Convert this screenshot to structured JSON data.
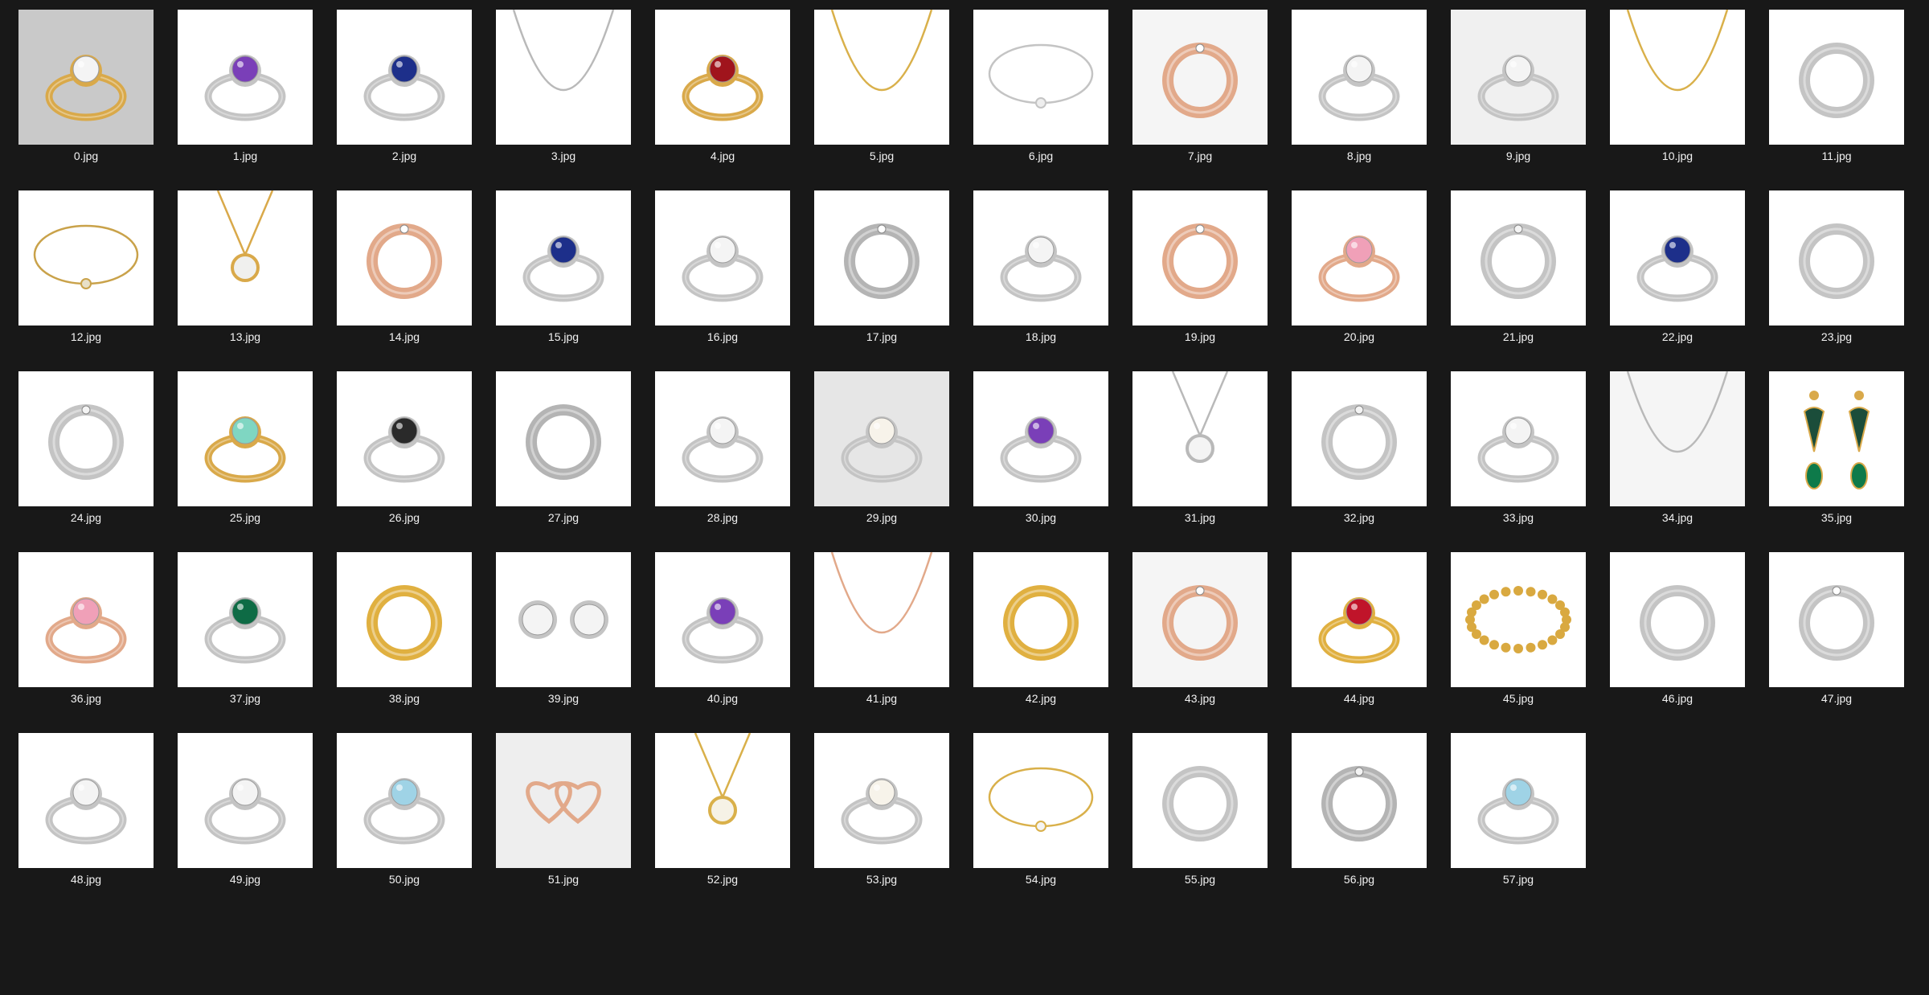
{
  "files": [
    {
      "name": "0.jpg",
      "item": "ring",
      "metal": "#d9a94a",
      "gem": "#f4f4f4",
      "bg": "#c9c9c9"
    },
    {
      "name": "1.jpg",
      "item": "ring",
      "metal": "#c4c4c4",
      "gem": "#7a3fb8",
      "bg": "#ffffff"
    },
    {
      "name": "2.jpg",
      "item": "ring",
      "metal": "#c4c4c4",
      "gem": "#1d2f8a",
      "bg": "#ffffff"
    },
    {
      "name": "3.jpg",
      "item": "necklace",
      "metal": "#b9b9b9",
      "gem": "",
      "bg": "#ffffff"
    },
    {
      "name": "4.jpg",
      "item": "ring",
      "metal": "#d9a94a",
      "gem": "#a0141c",
      "bg": "#ffffff"
    },
    {
      "name": "5.jpg",
      "item": "necklace",
      "metal": "#d9b04a",
      "gem": "",
      "bg": "#ffffff"
    },
    {
      "name": "6.jpg",
      "item": "bracelet",
      "metal": "#c4c4c4",
      "gem": "#eeeeee",
      "bg": "#ffffff"
    },
    {
      "name": "7.jpg",
      "item": "band",
      "metal": "#e2a98a",
      "gem": "#ffffff",
      "bg": "#f5f5f5"
    },
    {
      "name": "8.jpg",
      "item": "ring",
      "metal": "#c4c4c4",
      "gem": "#f4f4f4",
      "bg": "#ffffff"
    },
    {
      "name": "9.jpg",
      "item": "ring",
      "metal": "#c4c4c4",
      "gem": "#f4f4f4",
      "bg": "#f0f0f0"
    },
    {
      "name": "10.jpg",
      "item": "necklace",
      "metal": "#d9b04a",
      "gem": "",
      "bg": "#ffffff"
    },
    {
      "name": "11.jpg",
      "item": "band",
      "metal": "#c4c4c4",
      "gem": "",
      "bg": "#ffffff"
    },
    {
      "name": "12.jpg",
      "item": "bracelet",
      "metal": "#c9a24a",
      "gem": "#e8e0c8",
      "bg": "#ffffff"
    },
    {
      "name": "13.jpg",
      "item": "pendant",
      "metal": "#d9a94a",
      "gem": "#f0f0ee",
      "bg": "#ffffff"
    },
    {
      "name": "14.jpg",
      "item": "band",
      "metal": "#e2a98a",
      "gem": "#ffffff",
      "bg": "#ffffff"
    },
    {
      "name": "15.jpg",
      "item": "ring",
      "metal": "#c4c4c4",
      "gem": "#1d2f8a",
      "bg": "#ffffff"
    },
    {
      "name": "16.jpg",
      "item": "ring",
      "metal": "#c4c4c4",
      "gem": "#f4f4f4",
      "bg": "#ffffff"
    },
    {
      "name": "17.jpg",
      "item": "band",
      "metal": "#b4b4b4",
      "gem": "#ffffff",
      "bg": "#ffffff"
    },
    {
      "name": "18.jpg",
      "item": "ring",
      "metal": "#c4c4c4",
      "gem": "#f4f4f4",
      "bg": "#ffffff"
    },
    {
      "name": "19.jpg",
      "item": "band",
      "metal": "#e2a98a",
      "gem": "#ffffff",
      "bg": "#ffffff"
    },
    {
      "name": "20.jpg",
      "item": "ring",
      "metal": "#e2a98a",
      "gem": "#f0a0b8",
      "bg": "#ffffff"
    },
    {
      "name": "21.jpg",
      "item": "band",
      "metal": "#c4c4c4",
      "gem": "#f4f4f4",
      "bg": "#ffffff"
    },
    {
      "name": "22.jpg",
      "item": "ring",
      "metal": "#c4c4c4",
      "gem": "#1d2f8a",
      "bg": "#ffffff"
    },
    {
      "name": "23.jpg",
      "item": "band",
      "metal": "#c4c4c4",
      "gem": "",
      "bg": "#ffffff"
    },
    {
      "name": "24.jpg",
      "item": "band",
      "metal": "#c4c4c4",
      "gem": "#f4f4f4",
      "bg": "#ffffff"
    },
    {
      "name": "25.jpg",
      "item": "ring",
      "metal": "#d9a94a",
      "gem": "#7fd6c2",
      "bg": "#ffffff"
    },
    {
      "name": "26.jpg",
      "item": "ring",
      "metal": "#c4c4c4",
      "gem": "#2a2a2a",
      "bg": "#ffffff"
    },
    {
      "name": "27.jpg",
      "item": "band",
      "metal": "#b4b4b4",
      "gem": "",
      "bg": "#ffffff"
    },
    {
      "name": "28.jpg",
      "item": "ring",
      "metal": "#c4c4c4",
      "gem": "#f4f4f4",
      "bg": "#ffffff"
    },
    {
      "name": "29.jpg",
      "item": "ring",
      "metal": "#c4c4c4",
      "gem": "#f7f3ea",
      "bg": "#e6e6e6"
    },
    {
      "name": "30.jpg",
      "item": "ring",
      "metal": "#c4c4c4",
      "gem": "#7a3fb8",
      "bg": "#ffffff"
    },
    {
      "name": "31.jpg",
      "item": "pendant",
      "metal": "#b9b9b9",
      "gem": "#f4f4f4",
      "bg": "#ffffff"
    },
    {
      "name": "32.jpg",
      "item": "band",
      "metal": "#c4c4c4",
      "gem": "#f4f4f4",
      "bg": "#ffffff"
    },
    {
      "name": "33.jpg",
      "item": "ring",
      "metal": "#c4c4c4",
      "gem": "#f4f4f4",
      "bg": "#ffffff"
    },
    {
      "name": "34.jpg",
      "item": "necklace",
      "metal": "#b9b9b9",
      "gem": "",
      "bg": "#f5f5f5"
    },
    {
      "name": "35.jpg",
      "item": "earrings",
      "metal": "#d9a94a",
      "gem": "#0e7a4a",
      "bg": "#ffffff"
    },
    {
      "name": "36.jpg",
      "item": "ring",
      "metal": "#e2a98a",
      "gem": "#f0a0b8",
      "bg": "#ffffff"
    },
    {
      "name": "37.jpg",
      "item": "ring",
      "metal": "#c4c4c4",
      "gem": "#0e6b45",
      "bg": "#ffffff"
    },
    {
      "name": "38.jpg",
      "item": "band",
      "metal": "#e0b040",
      "gem": "",
      "bg": "#ffffff"
    },
    {
      "name": "39.jpg",
      "item": "studs",
      "metal": "#c4c4c4",
      "gem": "#f4f4f4",
      "bg": "#ffffff"
    },
    {
      "name": "40.jpg",
      "item": "ring",
      "metal": "#c4c4c4",
      "gem": "#7a3fb8",
      "bg": "#ffffff"
    },
    {
      "name": "41.jpg",
      "item": "necklace",
      "metal": "#e2a98a",
      "gem": "#1d2f8a",
      "bg": "#ffffff"
    },
    {
      "name": "42.jpg",
      "item": "band",
      "metal": "#e0b040",
      "gem": "",
      "bg": "#ffffff"
    },
    {
      "name": "43.jpg",
      "item": "band",
      "metal": "#e2a98a",
      "gem": "#ffffff",
      "bg": "#f5f5f5"
    },
    {
      "name": "44.jpg",
      "item": "ring",
      "metal": "#e0b040",
      "gem": "#c0142a",
      "bg": "#ffffff"
    },
    {
      "name": "45.jpg",
      "item": "beads",
      "metal": "#d9a940",
      "gem": "",
      "bg": "#ffffff"
    },
    {
      "name": "46.jpg",
      "item": "band",
      "metal": "#c4c4c4",
      "gem": "",
      "bg": "#ffffff"
    },
    {
      "name": "47.jpg",
      "item": "band",
      "metal": "#c4c4c4",
      "gem": "#ffffff",
      "bg": "#ffffff"
    },
    {
      "name": "48.jpg",
      "item": "ring",
      "metal": "#c4c4c4",
      "gem": "#f4f4f4",
      "bg": "#ffffff"
    },
    {
      "name": "49.jpg",
      "item": "ring",
      "metal": "#c4c4c4",
      "gem": "#f4f4f4",
      "bg": "#ffffff"
    },
    {
      "name": "50.jpg",
      "item": "ring",
      "metal": "#c4c4c4",
      "gem": "#9fd3e6",
      "bg": "#ffffff"
    },
    {
      "name": "51.jpg",
      "item": "hearts",
      "metal": "#e2a98a",
      "gem": "#ffffff",
      "bg": "#eeeeee"
    },
    {
      "name": "52.jpg",
      "item": "pendant",
      "metal": "#d9b04a",
      "gem": "#f6f2e6",
      "bg": "#ffffff"
    },
    {
      "name": "53.jpg",
      "item": "ring",
      "metal": "#c4c4c4",
      "gem": "#f7f3ea",
      "bg": "#ffffff"
    },
    {
      "name": "54.jpg",
      "item": "bracelet",
      "metal": "#d9b04a",
      "gem": "#f4f4f4",
      "bg": "#ffffff"
    },
    {
      "name": "55.jpg",
      "item": "band",
      "metal": "#c4c4c4",
      "gem": "",
      "bg": "#ffffff"
    },
    {
      "name": "56.jpg",
      "item": "band",
      "metal": "#b4b4b4",
      "gem": "#f4f4f4",
      "bg": "#ffffff"
    },
    {
      "name": "57.jpg",
      "item": "ring",
      "metal": "#c4c4c4",
      "gem": "#9fd3e6",
      "bg": "#ffffff"
    }
  ]
}
